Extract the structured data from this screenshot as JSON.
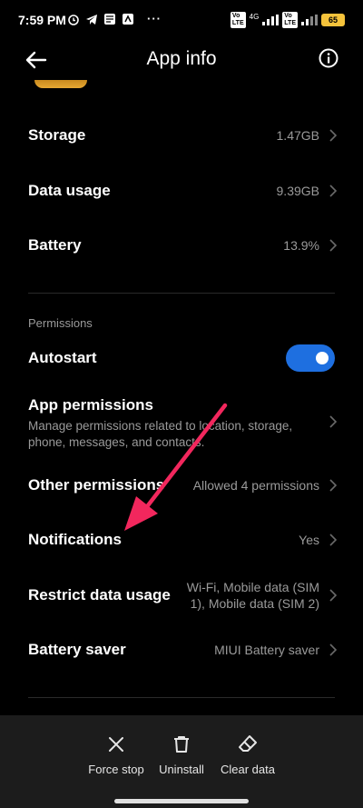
{
  "status_bar": {
    "time": "7:59 PM",
    "battery": "65",
    "network": "4G"
  },
  "header": {
    "title": "App info"
  },
  "rows": {
    "storage": {
      "label": "Storage",
      "value": "1.47GB"
    },
    "data_usage": {
      "label": "Data usage",
      "value": "9.39GB"
    },
    "battery": {
      "label": "Battery",
      "value": "13.9%"
    }
  },
  "permissions": {
    "section_title": "Permissions",
    "autostart": {
      "label": "Autostart",
      "enabled": true
    },
    "app_permissions": {
      "label": "App permissions",
      "description": "Manage permissions related to location, storage, phone, messages, and contacts."
    },
    "other_permissions": {
      "label": "Other permissions",
      "value": "Allowed 4 permissions"
    },
    "notifications": {
      "label": "Notifications",
      "value": "Yes"
    },
    "restrict_data_usage": {
      "label": "Restrict data usage",
      "value": "Wi-Fi, Mobile data (SIM 1), Mobile data (SIM 2)"
    },
    "battery_saver": {
      "label": "Battery saver",
      "value": "MIUI Battery saver"
    }
  },
  "bottom_actions": {
    "force_stop": "Force stop",
    "uninstall": "Uninstall",
    "clear_data": "Clear data"
  },
  "colors": {
    "background": "#000000",
    "accent_toggle": "#1e6fe0",
    "annotation_arrow": "#f2275d",
    "secondary_text": "#9a9a9a"
  }
}
